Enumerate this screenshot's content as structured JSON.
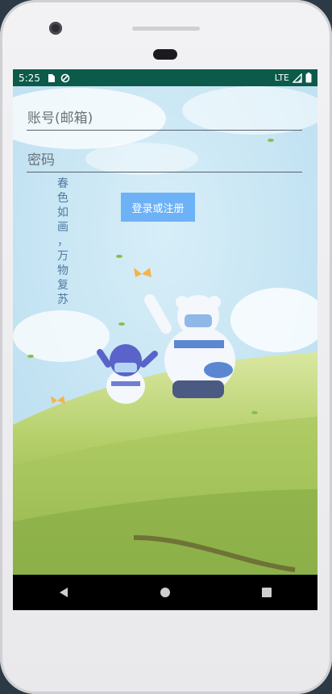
{
  "status_bar": {
    "time": "5:25",
    "network": "LTE",
    "icons": [
      "sim-card-icon",
      "data-saver-icon",
      "signal-icon",
      "battery-icon"
    ]
  },
  "form": {
    "account_placeholder": "账号(邮箱)",
    "password_placeholder": "密码",
    "login_button": "登录或注册"
  },
  "slogan": [
    "春",
    "色",
    "如",
    "画",
    "，",
    "万",
    "物",
    "复",
    "苏"
  ],
  "nav": {
    "back": "back-icon",
    "home": "home-icon",
    "recents": "recents-icon"
  },
  "colors": {
    "status_bar": "#0b5a4a",
    "button": "#6db1f7",
    "slogan": "#4e7aa0"
  }
}
